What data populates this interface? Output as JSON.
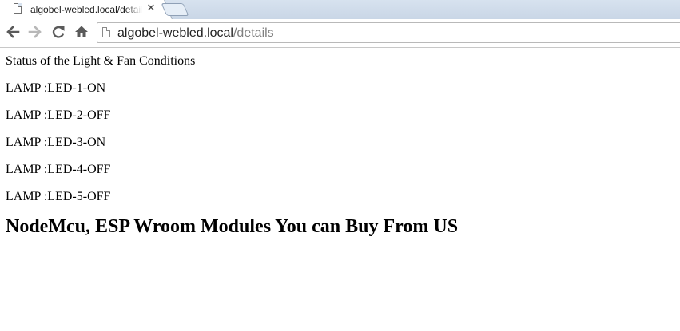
{
  "browser": {
    "tab": {
      "title": "algobel-webled.local/details",
      "close_glyph": "✕",
      "icon": "page-icon"
    },
    "new_tab_icon": "new-tab-icon",
    "toolbar": {
      "back_icon": "back-arrow-icon",
      "forward_icon": "forward-arrow-icon",
      "reload_icon": "reload-icon",
      "home_icon": "home-icon"
    },
    "omnibox": {
      "host": "algobel-webled.local",
      "path": "/details",
      "icon": "page-icon"
    }
  },
  "page": {
    "status_heading": "Status of the Light & Fan Conditions",
    "lamps": [
      {
        "label": "LAMP :LED-1-ON"
      },
      {
        "label": "LAMP :LED-2-OFF"
      },
      {
        "label": "LAMP :LED-3-ON"
      },
      {
        "label": "LAMP :LED-4-OFF"
      },
      {
        "label": "LAMP :LED-5-OFF"
      }
    ],
    "promo_heading": "NodeMcu, ESP Wroom Modules You can Buy From US"
  },
  "colors": {
    "tabstrip": "#cfdbe9",
    "url_host": "#222222",
    "url_path": "#808080",
    "icon": "#5a5a5a",
    "icon_disabled": "#b8b8b8"
  }
}
